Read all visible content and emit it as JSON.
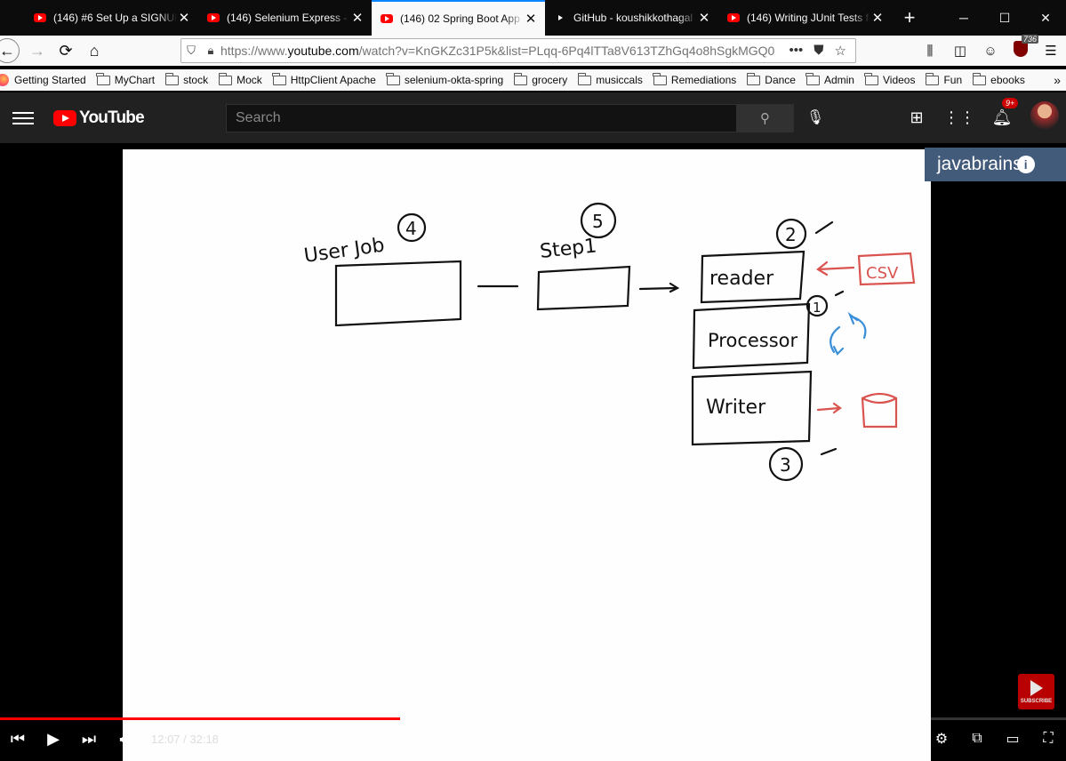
{
  "browser": {
    "tabs": [
      {
        "title": "(146) #6 Set Up a SIGNUP",
        "active": false
      },
      {
        "title": "(146) Selenium Express - ",
        "active": false
      },
      {
        "title": "(146) 02 Spring Boot App",
        "active": true
      },
      {
        "title": "GitHub - koushikkothagal",
        "active": false
      },
      {
        "title": "(146) Writing JUnit Tests fo",
        "active": false
      }
    ],
    "url_prefix": "https://www.",
    "url_domain": "youtube.com",
    "url_rest": "/watch?v=KnGKZc31P5k&list=PLqq-6Pq4lTTa8V613TZhGq4o8hSgkMGQ0",
    "ublock_count": "736",
    "bookmarks": [
      "Getting Started",
      "MyChart",
      "stock",
      "Mock",
      "HttpClient Apache",
      "selenium-okta-spring",
      "grocery",
      "musiccals",
      "Remediations",
      "Dance",
      "Admin",
      "Videos",
      "Fun",
      "ebooks"
    ]
  },
  "youtube": {
    "logo": "YouTube",
    "search_placeholder": "Search",
    "notif_badge": "9+"
  },
  "video": {
    "watermark": "javabrains",
    "current_time": "12:07",
    "duration": "32:18",
    "time_display": "12:07 / 32:18",
    "progress_fraction": 0.375,
    "subscribe_label": "SUBSCRIBE",
    "cc_label": "CC",
    "diagram": {
      "job_label": "User Job",
      "job_num": "4",
      "step_label": "Step1",
      "step_num": "5",
      "reader_label": "reader",
      "reader_num": "2",
      "processor_label": "Processor",
      "processor_num": "1",
      "writer_label": "Writer",
      "writer_num": "3",
      "csv_label": "CSV"
    }
  }
}
